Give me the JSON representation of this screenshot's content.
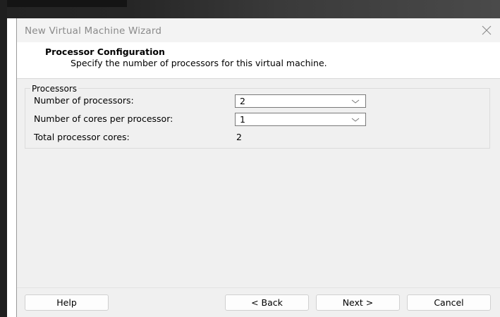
{
  "window": {
    "title": "New Virtual Machine Wizard",
    "close_icon": "close-icon"
  },
  "header": {
    "title": "Processor Configuration",
    "subtitle": "Specify the number of processors for this virtual machine."
  },
  "processors": {
    "group_label": "Processors",
    "num_processors_label": "Number of processors:",
    "num_processors_value": "2",
    "cores_per_processor_label": "Number of cores per processor:",
    "cores_per_processor_value": "1",
    "total_cores_label": "Total processor cores:",
    "total_cores_value": "2"
  },
  "footer": {
    "help_label": "Help",
    "back_label": "< Back",
    "next_label": "Next >",
    "cancel_label": "Cancel"
  },
  "colors": {
    "dialog_bg": "#f0f0f0",
    "header_bg": "#ffffff",
    "title_text": "#8a8a8a"
  }
}
